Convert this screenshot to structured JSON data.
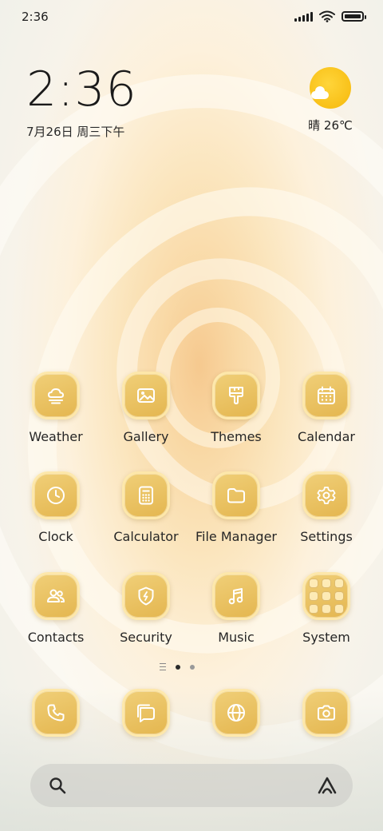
{
  "status_bar": {
    "time": "2:36"
  },
  "clock_widget": {
    "time": "2:36",
    "date": "7月26日 周三下午"
  },
  "weather_widget": {
    "condition_temp": "晴 26℃"
  },
  "apps": [
    {
      "label": "Weather",
      "icon": "weather-icon"
    },
    {
      "label": "Gallery",
      "icon": "gallery-icon"
    },
    {
      "label": "Themes",
      "icon": "themes-icon"
    },
    {
      "label": "Calendar",
      "icon": "calendar-icon"
    },
    {
      "label": "Clock",
      "icon": "clock-icon"
    },
    {
      "label": "Calculator",
      "icon": "calculator-icon"
    },
    {
      "label": "File Manager",
      "icon": "folder-icon"
    },
    {
      "label": "Settings",
      "icon": "gear-icon"
    },
    {
      "label": "Contacts",
      "icon": "contacts-icon"
    },
    {
      "label": "Security",
      "icon": "shield-icon"
    },
    {
      "label": "Music",
      "icon": "music-icon"
    },
    {
      "label": "System",
      "icon": "folder-grid-icon"
    }
  ],
  "dock": [
    {
      "icon": "phone-icon"
    },
    {
      "icon": "messages-icon"
    },
    {
      "icon": "browser-icon"
    },
    {
      "icon": "camera-icon"
    }
  ],
  "page_indicator": {
    "pages": 2,
    "current": 1
  },
  "colors": {
    "icon_gold": "#e8bd58",
    "text": "#262626",
    "sun": "#f6b80a"
  }
}
